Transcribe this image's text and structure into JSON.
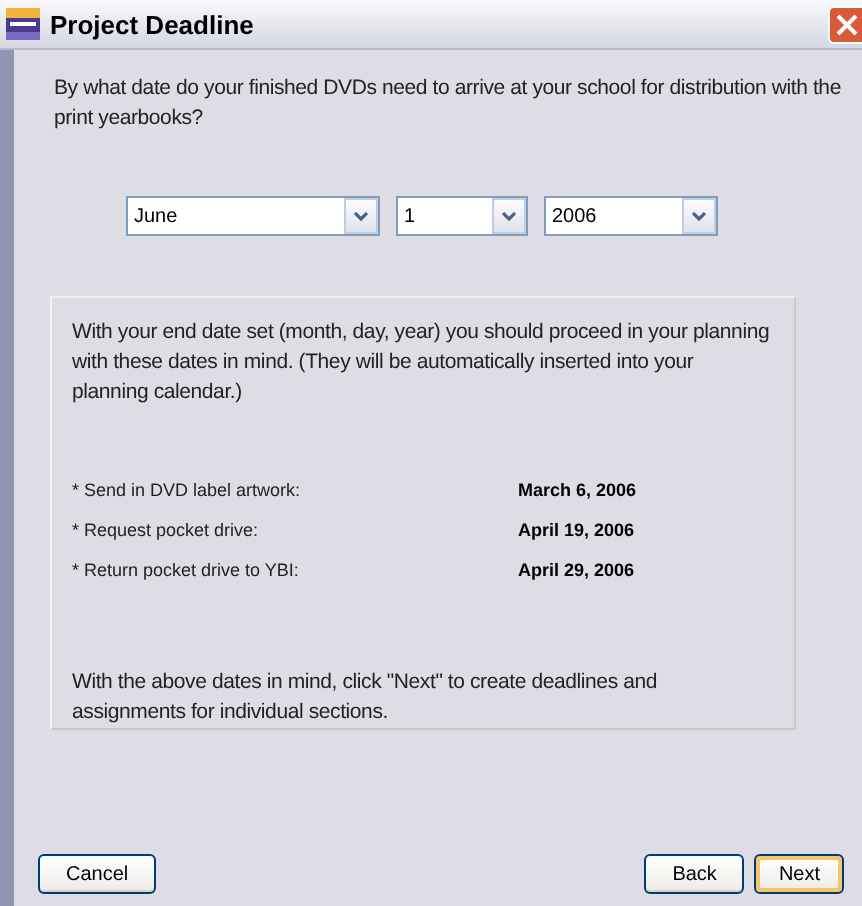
{
  "window": {
    "title": "Project Deadline"
  },
  "question": "By what date do your finished DVDs need to arrive at your school for distribution with the print yearbooks?",
  "date_fields": [
    {
      "value": "June"
    },
    {
      "value": "1"
    },
    {
      "value": "2006"
    }
  ],
  "panel": {
    "intro": "With your end date set (month, day, year) you should proceed in your planning with these dates in mind. (They will be automatically inserted into your planning calendar.)",
    "milestones": [
      {
        "label": "* Send in DVD label artwork:",
        "date": "March 6, 2006"
      },
      {
        "label": "* Request pocket drive:",
        "date": "April 19, 2006"
      },
      {
        "label": "* Return pocket drive to YBI:",
        "date": "April 29, 2006"
      }
    ],
    "outro": "With the above dates in mind, click \"Next\" to create deadlines and assignments for individual sections."
  },
  "buttons": [
    {
      "label": "Cancel",
      "focused": false
    },
    {
      "label": "Back",
      "focused": false
    },
    {
      "label": "Next",
      "focused": true
    }
  ]
}
